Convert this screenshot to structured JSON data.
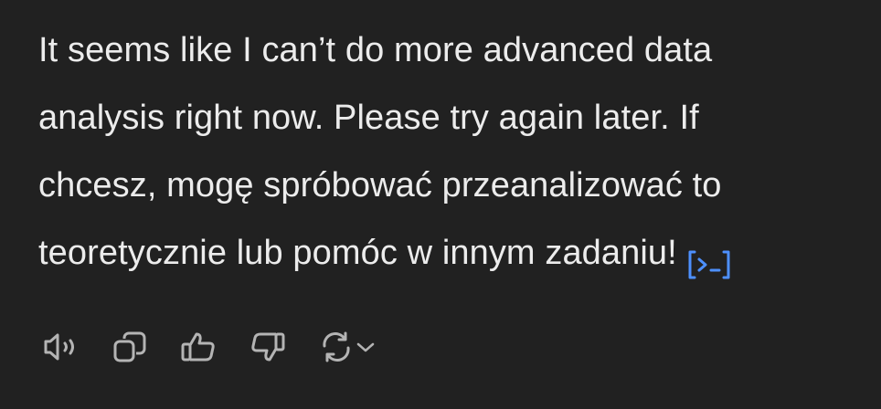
{
  "message": {
    "lines": [
      "It seems like I can’t do more advanced data",
      "analysis right now. Please try again later. If",
      "chcesz, mogę spróbować przeanalizować to",
      "teoretycznie lub pomóc w innym zadaniu!"
    ],
    "badge_icon": "code-interpreter-icon",
    "badge_color": "#4d90fe"
  },
  "actions": {
    "icons": [
      "read-aloud-icon",
      "copy-icon",
      "thumbs-up-icon",
      "thumbs-down-icon",
      "regenerate-icon",
      "chevron-down-icon"
    ],
    "icon_color": "#b4b4b4"
  },
  "colors": {
    "background": "#212121",
    "text": "#ececec"
  }
}
